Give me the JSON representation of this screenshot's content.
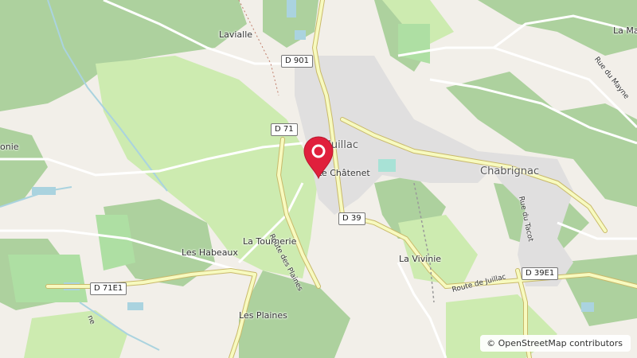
{
  "map": {
    "places": {
      "lavialle": "Lavialle",
      "la_main": "La Mai",
      "juillac": "Juillac",
      "le_chatenet": "Le Châtenet",
      "chabrignac": "Chabrignac",
      "onie": "onie",
      "la_tournerie": "La Tournerie",
      "les_habeaux": "Les Habeaux",
      "la_vivinie": "La Vivinie",
      "les_plaines": "Les Plaines"
    },
    "road_shields": {
      "d901": "D 901",
      "d71": "D 71",
      "d39": "D 39",
      "d71e1": "D 71E1",
      "d39e1": "D 39E1"
    },
    "street_names": {
      "route_des_plaines": "Route des Plaines",
      "route_de_juillac": "Route de Juillac",
      "rue_du_mayne": "Rue du Mayne",
      "rue_du_tacot": "Rue du Tacot",
      "creek": "ne"
    },
    "marker": {
      "icon": "map-pin-icon",
      "color": "#e0203c"
    },
    "attribution": {
      "symbol": "©",
      "text": "OpenStreetMap contributors"
    }
  }
}
